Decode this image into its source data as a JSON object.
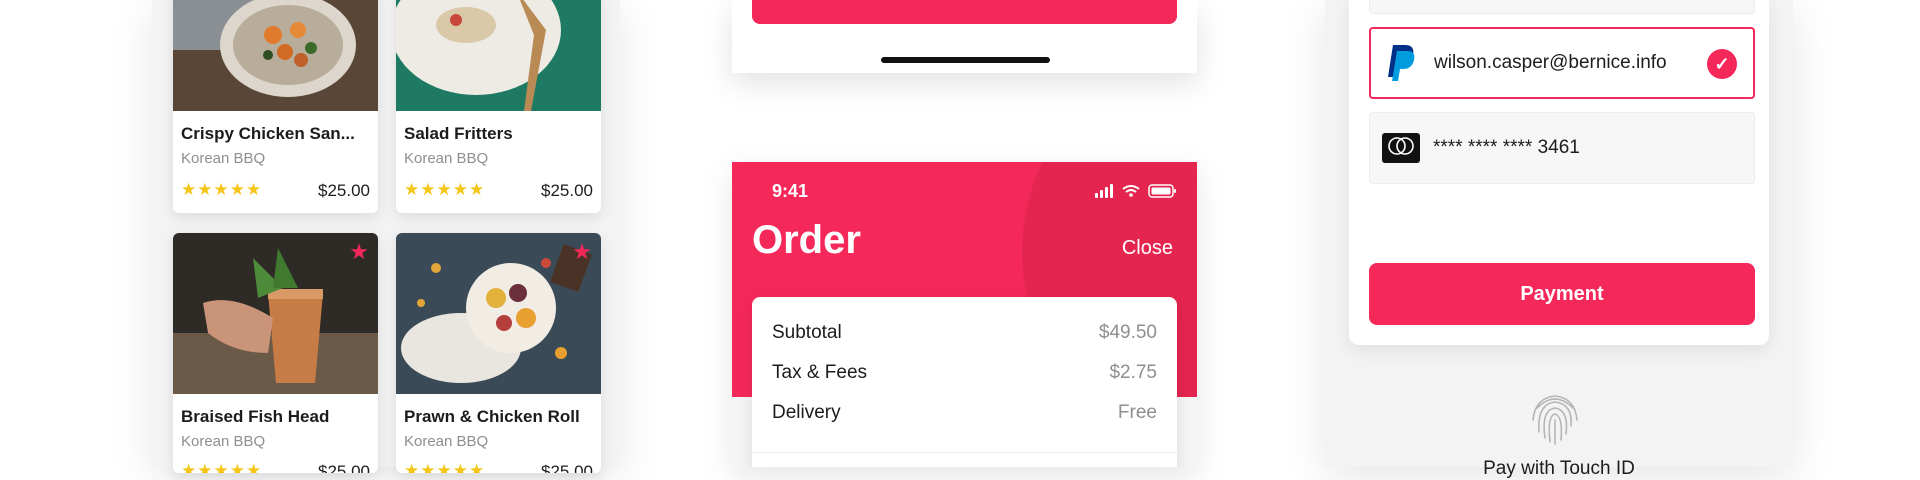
{
  "colors": {
    "accent": "#f5285a",
    "star": "#f5c518",
    "muted": "#8e8e93"
  },
  "food_cards": [
    {
      "title": "Crispy Chicken San...",
      "subtitle": "Korean BBQ",
      "stars": "★★★★★",
      "price": "$25.00"
    },
    {
      "title": "Salad Fritters",
      "subtitle": "Korean BBQ",
      "stars": "★★★★★",
      "price": "$25.00"
    },
    {
      "title": "Braised Fish Head",
      "subtitle": "Korean BBQ",
      "stars": "★★★★★",
      "price": "$25.00",
      "favorite": true
    },
    {
      "title": "Prawn & Chicken Roll",
      "subtitle": "Korean BBQ",
      "stars": "★★★★★",
      "price": "$25.00",
      "favorite": true
    }
  ],
  "order_screen": {
    "status_time": "9:41",
    "title": "Order",
    "close_label": "Close",
    "summary": [
      {
        "label": "Subtotal",
        "value": "$49.50"
      },
      {
        "label": "Tax & Fees",
        "value": "$2.75"
      },
      {
        "label": "Delivery",
        "value": "Free"
      }
    ]
  },
  "payment_screen": {
    "methods": [
      {
        "icon": "paypal-icon",
        "text": "wilson.casper@bernice.info",
        "selected": true
      },
      {
        "icon": "mastercard-icon",
        "text": "**** **** **** 3461",
        "selected": false
      }
    ],
    "payment_button": "Payment",
    "touch_id_label": "Pay with Touch ID"
  }
}
